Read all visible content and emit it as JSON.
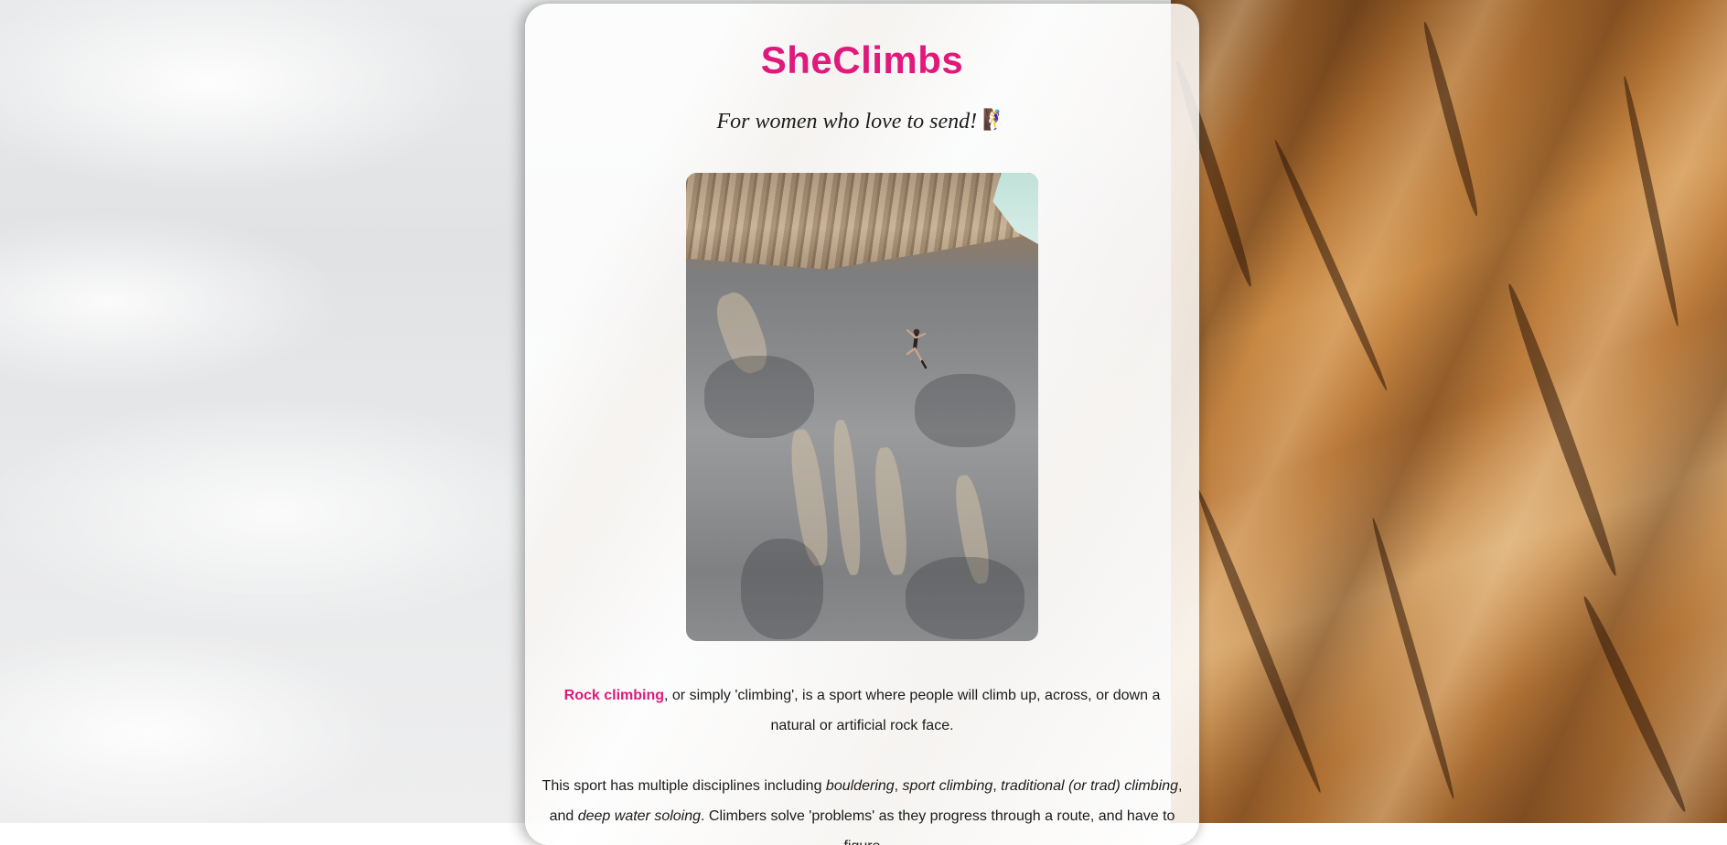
{
  "site": {
    "title": "SheClimbs",
    "tagline": "For women who love to send!",
    "tagline_emoji": "🧗‍♀️"
  },
  "hero_image": {
    "icon": "climber-on-limestone-wall-photo"
  },
  "intro": {
    "link_text": "Rock climbing",
    "text": ", or simply 'climbing', is a sport where people will climb up, across, or down a natural or artificial rock face."
  },
  "disciplines": {
    "lead": "This sport has multiple disciplines including ",
    "items": [
      "bouldering",
      "sport climbing",
      "traditional (or trad) climbing",
      "deep water soloing"
    ],
    "sep1": ", ",
    "sep2": ", ",
    "sep3": ", and ",
    "tail": ". Climbers solve 'problems' as they progress through a route, and have to figure"
  },
  "colors": {
    "accent": "#e0197d",
    "text": "#1b1b1b",
    "card": "#ffffff"
  }
}
